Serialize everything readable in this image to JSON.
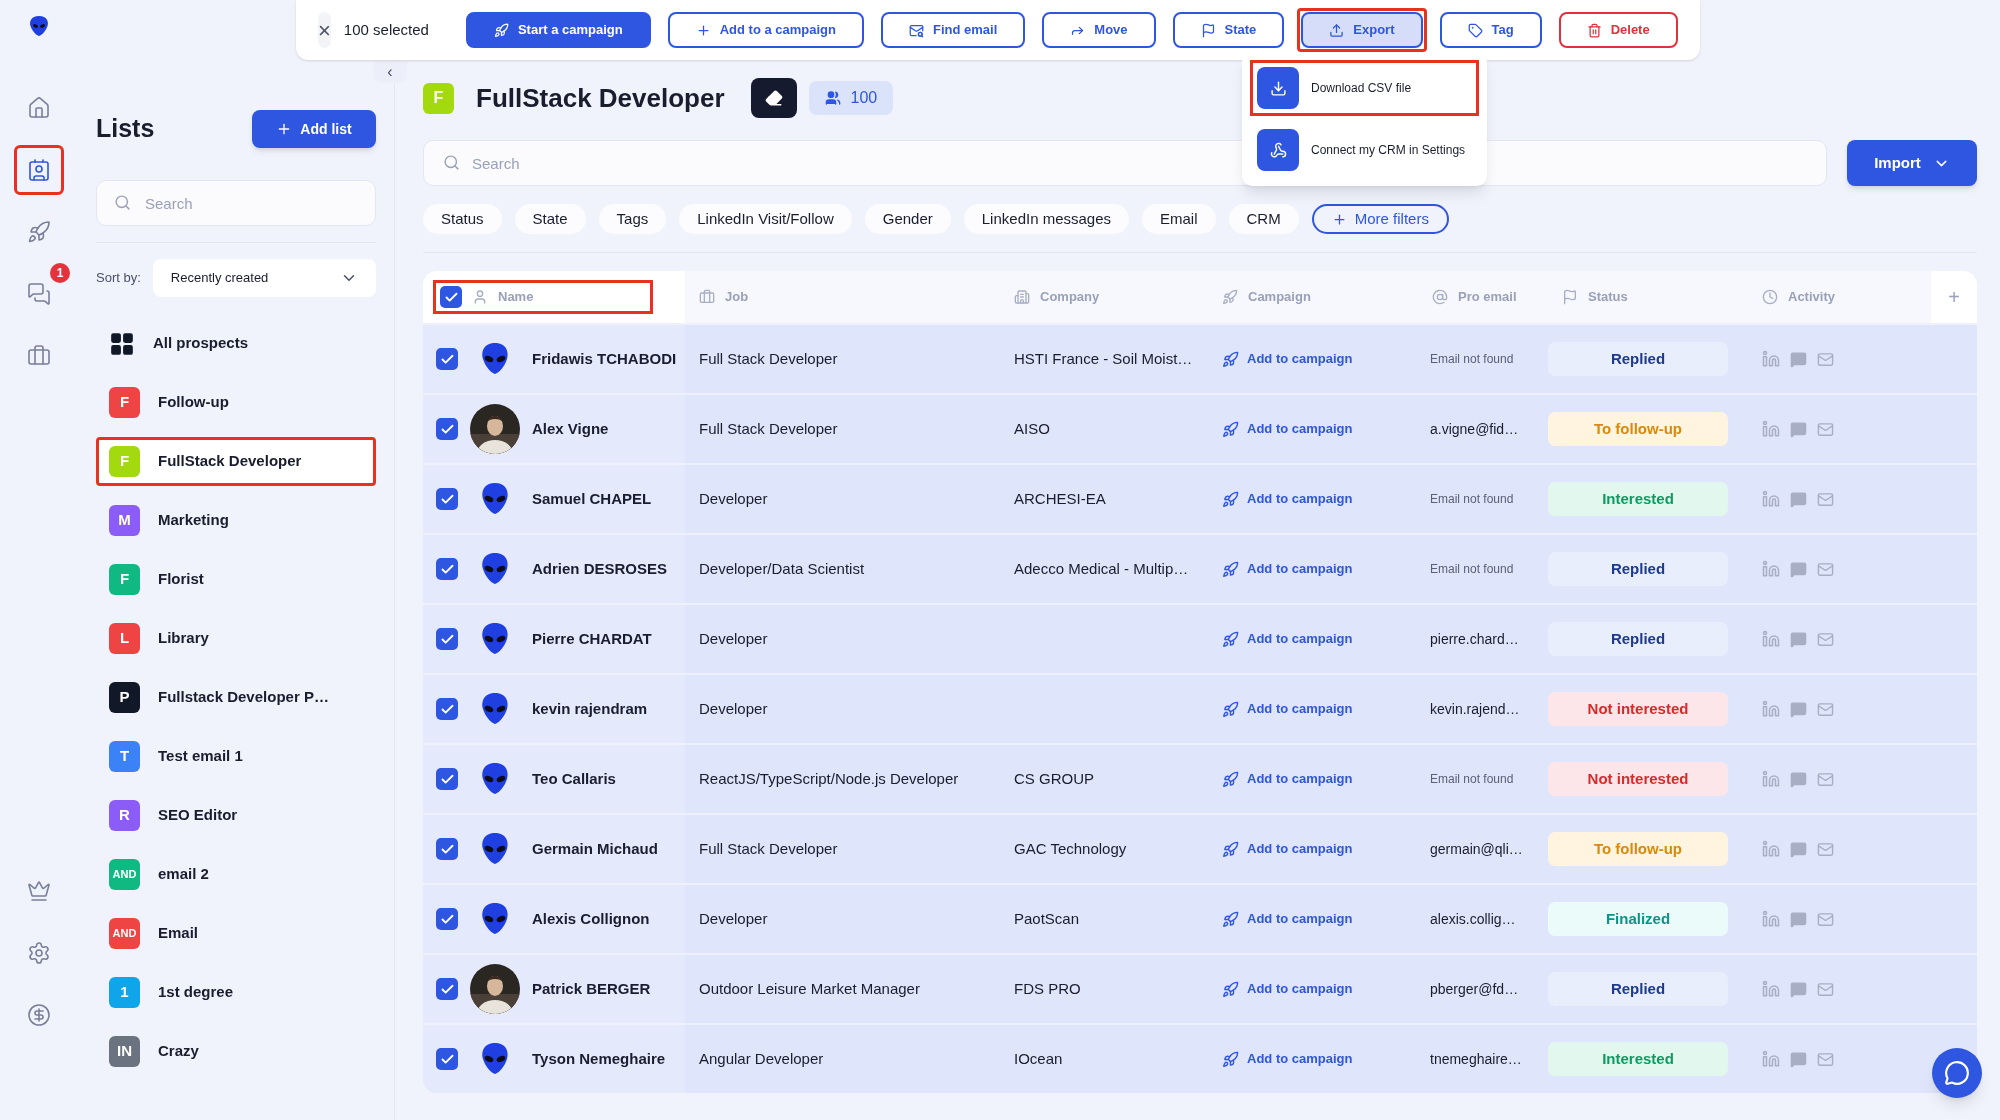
{
  "action_bar": {
    "close": "×",
    "selected_count": "100 selected",
    "buttons": [
      {
        "label": "Start a campaign",
        "kind": "primary",
        "selected": false,
        "highlighted": false
      },
      {
        "label": "Add to a campaign",
        "kind": "outline",
        "selected": false,
        "highlighted": false
      },
      {
        "label": "Find email",
        "kind": "outline",
        "selected": false,
        "highlighted": false
      },
      {
        "label": "Move",
        "kind": "outline",
        "selected": false,
        "highlighted": false
      },
      {
        "label": "State",
        "kind": "outline",
        "selected": false,
        "highlighted": false
      },
      {
        "label": "Export",
        "kind": "outline",
        "selected": true,
        "highlighted": true
      },
      {
        "label": "Tag",
        "kind": "outline",
        "selected": false,
        "highlighted": false
      },
      {
        "label": "Delete",
        "kind": "danger",
        "selected": false,
        "highlighted": false
      }
    ]
  },
  "export_menu": {
    "items": [
      {
        "label": "Download CSV file",
        "highlighted": true
      },
      {
        "label": "Connect my CRM in Settings",
        "highlighted": false
      }
    ]
  },
  "rail": {
    "top_items": [
      {
        "selected": false,
        "highlighted": false
      },
      {
        "selected": true,
        "highlighted": true
      },
      {
        "selected": false,
        "highlighted": false
      },
      {
        "selected": false,
        "highlighted": false,
        "badge": "1"
      },
      {
        "selected": false,
        "highlighted": false
      }
    ],
    "bottom_items": [
      {
        "selected": false,
        "highlighted": false
      },
      {
        "selected": false,
        "highlighted": false
      },
      {
        "selected": false,
        "highlighted": false
      }
    ]
  },
  "lists_panel": {
    "title": "Lists",
    "add_button": "Add list",
    "search": {
      "placeholder": "Search"
    },
    "sort_label": "Sort by:",
    "sort_value": "Recently created",
    "items": [
      {
        "kind": "all",
        "label": "All prospects",
        "selected": false,
        "highlighted": false
      },
      {
        "kind": "list",
        "badge": "F",
        "color": "#ef4444",
        "label": "Follow-up",
        "selected": false,
        "highlighted": false
      },
      {
        "kind": "list",
        "badge": "F",
        "color": "#a3d90f",
        "label": "FullStack Developer",
        "selected": true,
        "highlighted": true
      },
      {
        "kind": "list",
        "badge": "M",
        "color": "#8b5cf6",
        "label": "Marketing",
        "selected": false,
        "highlighted": false
      },
      {
        "kind": "list",
        "badge": "F",
        "color": "#10b981",
        "label": "Florist",
        "selected": false,
        "highlighted": false
      },
      {
        "kind": "list",
        "badge": "L",
        "color": "#ef4444",
        "label": "Library",
        "selected": false,
        "highlighted": false
      },
      {
        "kind": "list",
        "badge": "P",
        "color": "#111827",
        "label": "Fullstack Developer P…",
        "selected": false,
        "highlighted": false
      },
      {
        "kind": "list",
        "badge": "T",
        "color": "#3b82f6",
        "label": "Test email 1",
        "selected": false,
        "highlighted": false
      },
      {
        "kind": "list",
        "badge": "R",
        "color": "#8b5cf6",
        "label": "SEO Editor",
        "selected": false,
        "highlighted": false
      },
      {
        "kind": "list",
        "badge": "AND",
        "color": "#10b981",
        "label": "email 2",
        "selected": false,
        "highlighted": false
      },
      {
        "kind": "list",
        "badge": "AND",
        "color": "#ef4444",
        "label": "Email",
        "selected": false,
        "highlighted": false
      },
      {
        "kind": "list",
        "badge": "1",
        "color": "#0ea5e9",
        "label": "1st degree",
        "selected": false,
        "highlighted": false
      },
      {
        "kind": "list",
        "badge": "IN",
        "color": "#6b7280",
        "label": "Crazy",
        "selected": false,
        "highlighted": false
      }
    ]
  },
  "main": {
    "collapse": "‹",
    "list_badge": {
      "label": "F",
      "color": "#a3d90f"
    },
    "title": "FullStack Developer",
    "count": "100",
    "search": {
      "placeholder": "Search"
    },
    "import_button": "Import",
    "filters": [
      "Status",
      "State",
      "Tags",
      "LinkedIn Visit/Follow",
      "Gender",
      "LinkedIn messages",
      "Email",
      "CRM"
    ],
    "more_filters": "More filters"
  },
  "table": {
    "select_all": {
      "checked": true
    },
    "columns": [
      {
        "label": "Name",
        "highlighted": true
      },
      {
        "label": "Job",
        "highlighted": false
      },
      {
        "label": "Company",
        "highlighted": false
      },
      {
        "label": "Campaign",
        "highlighted": false
      },
      {
        "label": "Pro email",
        "highlighted": false
      },
      {
        "label": "Status",
        "highlighted": false
      },
      {
        "label": "Activity",
        "highlighted": false
      }
    ],
    "add_column": "+",
    "rows": [
      {
        "checked": true,
        "avatar": {
          "kind": "alien"
        },
        "name": "Fridawis TCHABODI",
        "job": "Full Stack Developer",
        "company": "HSTI France - Soil Moist…",
        "campaign": "Add to campaign",
        "pro_email": "Email not found",
        "email_found": false,
        "status": {
          "label": "Replied",
          "kind": "replied"
        }
      },
      {
        "checked": true,
        "name": "Alex Vigne",
        "job": "Full Stack Developer",
        "company": "AISO",
        "campaign": "Add to campaign",
        "pro_email": "a.vigne@fid…",
        "email_found": true,
        "status": {
          "label": "To follow-up",
          "kind": "follow_up"
        }
      },
      {
        "checked": true,
        "avatar": {
          "kind": "alien"
        },
        "name": "Samuel CHAPEL",
        "job": "Developer",
        "company": "ARCHESI-EA",
        "campaign": "Add to campaign",
        "pro_email": "Email not found",
        "email_found": false,
        "status": {
          "label": "Interested",
          "kind": "interested"
        }
      },
      {
        "checked": true,
        "avatar": {
          "kind": "alien"
        },
        "name": "Adrien DESROSES",
        "job": "Developer/Data Scientist",
        "company": "Adecco Medical - Multip…",
        "campaign": "Add to campaign",
        "pro_email": "Email not found",
        "email_found": false,
        "status": {
          "label": "Replied",
          "kind": "replied"
        }
      },
      {
        "checked": true,
        "avatar": {
          "kind": "alien"
        },
        "name": "Pierre CHARDAT",
        "job": "Developer",
        "campaign": "Add to campaign",
        "pro_email": "pierre.chard…",
        "email_found": true,
        "status": {
          "label": "Replied",
          "kind": "replied"
        }
      },
      {
        "checked": true,
        "avatar": {
          "kind": "alien"
        },
        "name": "kevin rajendram",
        "job": "Developer",
        "campaign": "Add to campaign",
        "pro_email": "kevin.rajend…",
        "email_found": true,
        "status": {
          "label": "Not interested",
          "kind": "not_interested"
        }
      },
      {
        "checked": true,
        "avatar": {
          "kind": "alien"
        },
        "name": "Teo Callaris",
        "job": "ReactJS/TypeScript/Node.js Developer",
        "company": "CS GROUP",
        "campaign": "Add to campaign",
        "pro_email": "Email not found",
        "email_found": false,
        "status": {
          "label": "Not interested",
          "kind": "not_interested"
        }
      },
      {
        "checked": true,
        "avatar": {
          "kind": "alien"
        },
        "name": "Germain Michaud",
        "job": "Full Stack Developer",
        "company": "GAC Technology",
        "campaign": "Add to campaign",
        "pro_email": "germain@qli…",
        "email_found": true,
        "status": {
          "label": "To follow-up",
          "kind": "follow_up"
        }
      },
      {
        "checked": true,
        "avatar": {
          "kind": "alien"
        },
        "name": "Alexis Collignon",
        "job": "Developer",
        "company": "PaotScan",
        "campaign": "Add to campaign",
        "pro_email": "alexis.collig…",
        "email_found": true,
        "status": {
          "label": "Finalized",
          "kind": "finalized"
        }
      },
      {
        "checked": true,
        "name": "Patrick BERGER",
        "job": "Outdoor Leisure Market Manager",
        "company": "FDS PRO",
        "campaign": "Add to campaign",
        "pro_email": "pberger@fd…",
        "email_found": true,
        "status": {
          "label": "Replied",
          "kind": "replied"
        }
      },
      {
        "checked": true,
        "avatar": {
          "kind": "alien"
        },
        "name": "Tyson Nemeghaire",
        "job": "Angular Developer",
        "company": "IOcean",
        "campaign": "Add to campaign",
        "pro_email": "tnemeghaire…",
        "email_found": true,
        "status": {
          "label": "Interested",
          "kind": "interested"
        }
      }
    ]
  }
}
